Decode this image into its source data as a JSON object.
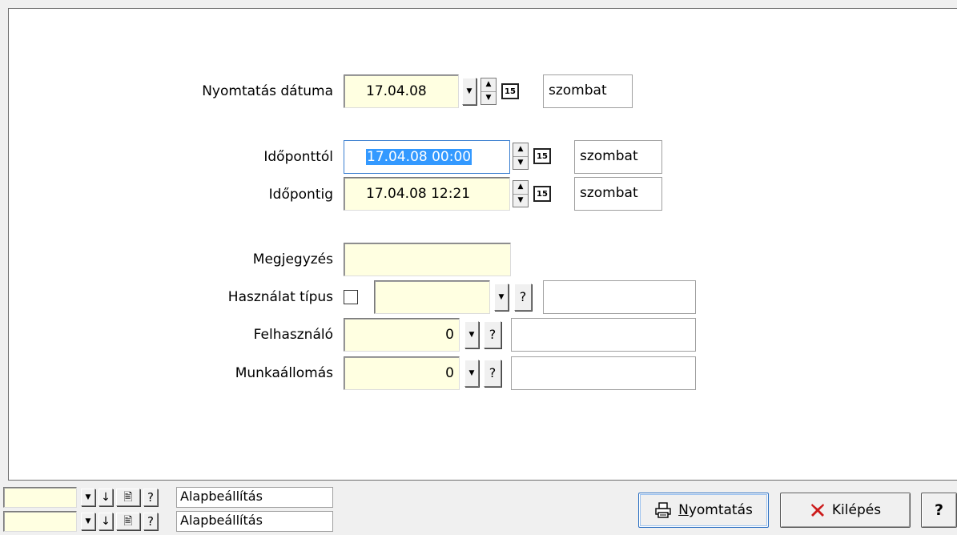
{
  "form": {
    "print_date_label": "Nyomtatás dátuma",
    "print_date_value": "17.04.08",
    "print_date_day": "szombat",
    "from_label": "Időponttól",
    "from_value": "17.04.08 00:00",
    "from_day": "szombat",
    "to_label": "Időpontig",
    "to_value": "17.04.08 12:21",
    "to_day": "szombat",
    "note_label": "Megjegyzés",
    "note_value": "",
    "usage_type_label": "Használat típus",
    "usage_type_checked": false,
    "usage_type_value": "",
    "usage_type_desc": "",
    "user_label": "Felhasználó",
    "user_value": "0",
    "user_desc": "",
    "workstation_label": "Munkaállomás",
    "workstation_value": "0",
    "workstation_desc": "",
    "calendar_glyph": "15",
    "help_glyph": "?"
  },
  "footer": {
    "preset_rows": [
      {
        "value": "",
        "label": "Alapbeállítás"
      },
      {
        "value": "",
        "label": "Alapbeállítás"
      }
    ],
    "print_button_label": "Nyomtatás",
    "print_button_mnemonic": "N",
    "print_button_rest": "yomtatás",
    "exit_button_label": "Kilépés",
    "help_button_label": "?"
  },
  "icons": {
    "dropdown": "chevron-down-icon",
    "arrow_down": "arrow-down-icon",
    "document": "document-icon",
    "printer": "printer-icon",
    "exit": "red-x-icon",
    "spin": "spin-up-down-icon",
    "calendar": "calendar-icon"
  },
  "colors": {
    "field_bg": "#ffffe1",
    "selection": "#3399ff",
    "exit_x": "#cc1b1b"
  }
}
